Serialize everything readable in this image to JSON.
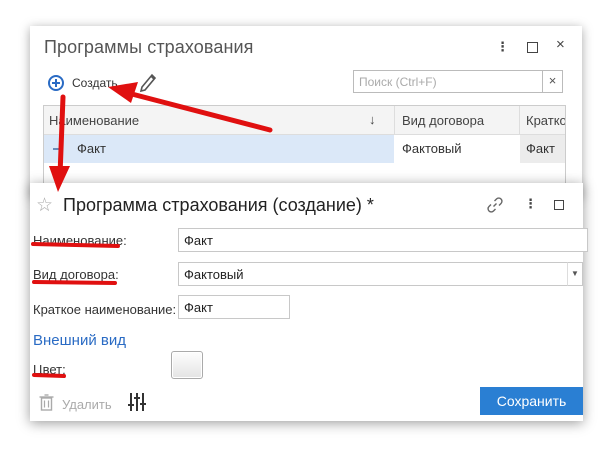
{
  "list_window": {
    "title": "Программы страхования",
    "kebab": "⋮",
    "close": "×",
    "create_label": "Создать",
    "search_placeholder": "Поиск (Ctrl+F)",
    "search_clear": "×",
    "columns": [
      "Наименование",
      "Вид договора",
      "Кратко"
    ],
    "sort_arrow": "↓",
    "rows": [
      {
        "name": "Факт",
        "type": "Фактовый",
        "short": "Факт"
      }
    ]
  },
  "form_window": {
    "title": "Программа страхования (создание) *",
    "star": "☆",
    "kebab": "⋮",
    "fields": {
      "name_label": "Наименование:",
      "name_value": "Факт",
      "type_label": "Вид договора:",
      "type_value": "Фактовый",
      "short_label": "Краткое наименование:",
      "short_value": "Факт"
    },
    "section_appearance": "Внешний вид",
    "color_label": "Цвет:",
    "delete_label": "Удалить",
    "save_label": "Сохранить",
    "dropdown_arrow": "▼"
  },
  "colors": {
    "accent": "#2a7fd3",
    "link_blue": "#2a6bc4",
    "annotation_red": "#e01010",
    "selection": "#dbe8f8"
  }
}
